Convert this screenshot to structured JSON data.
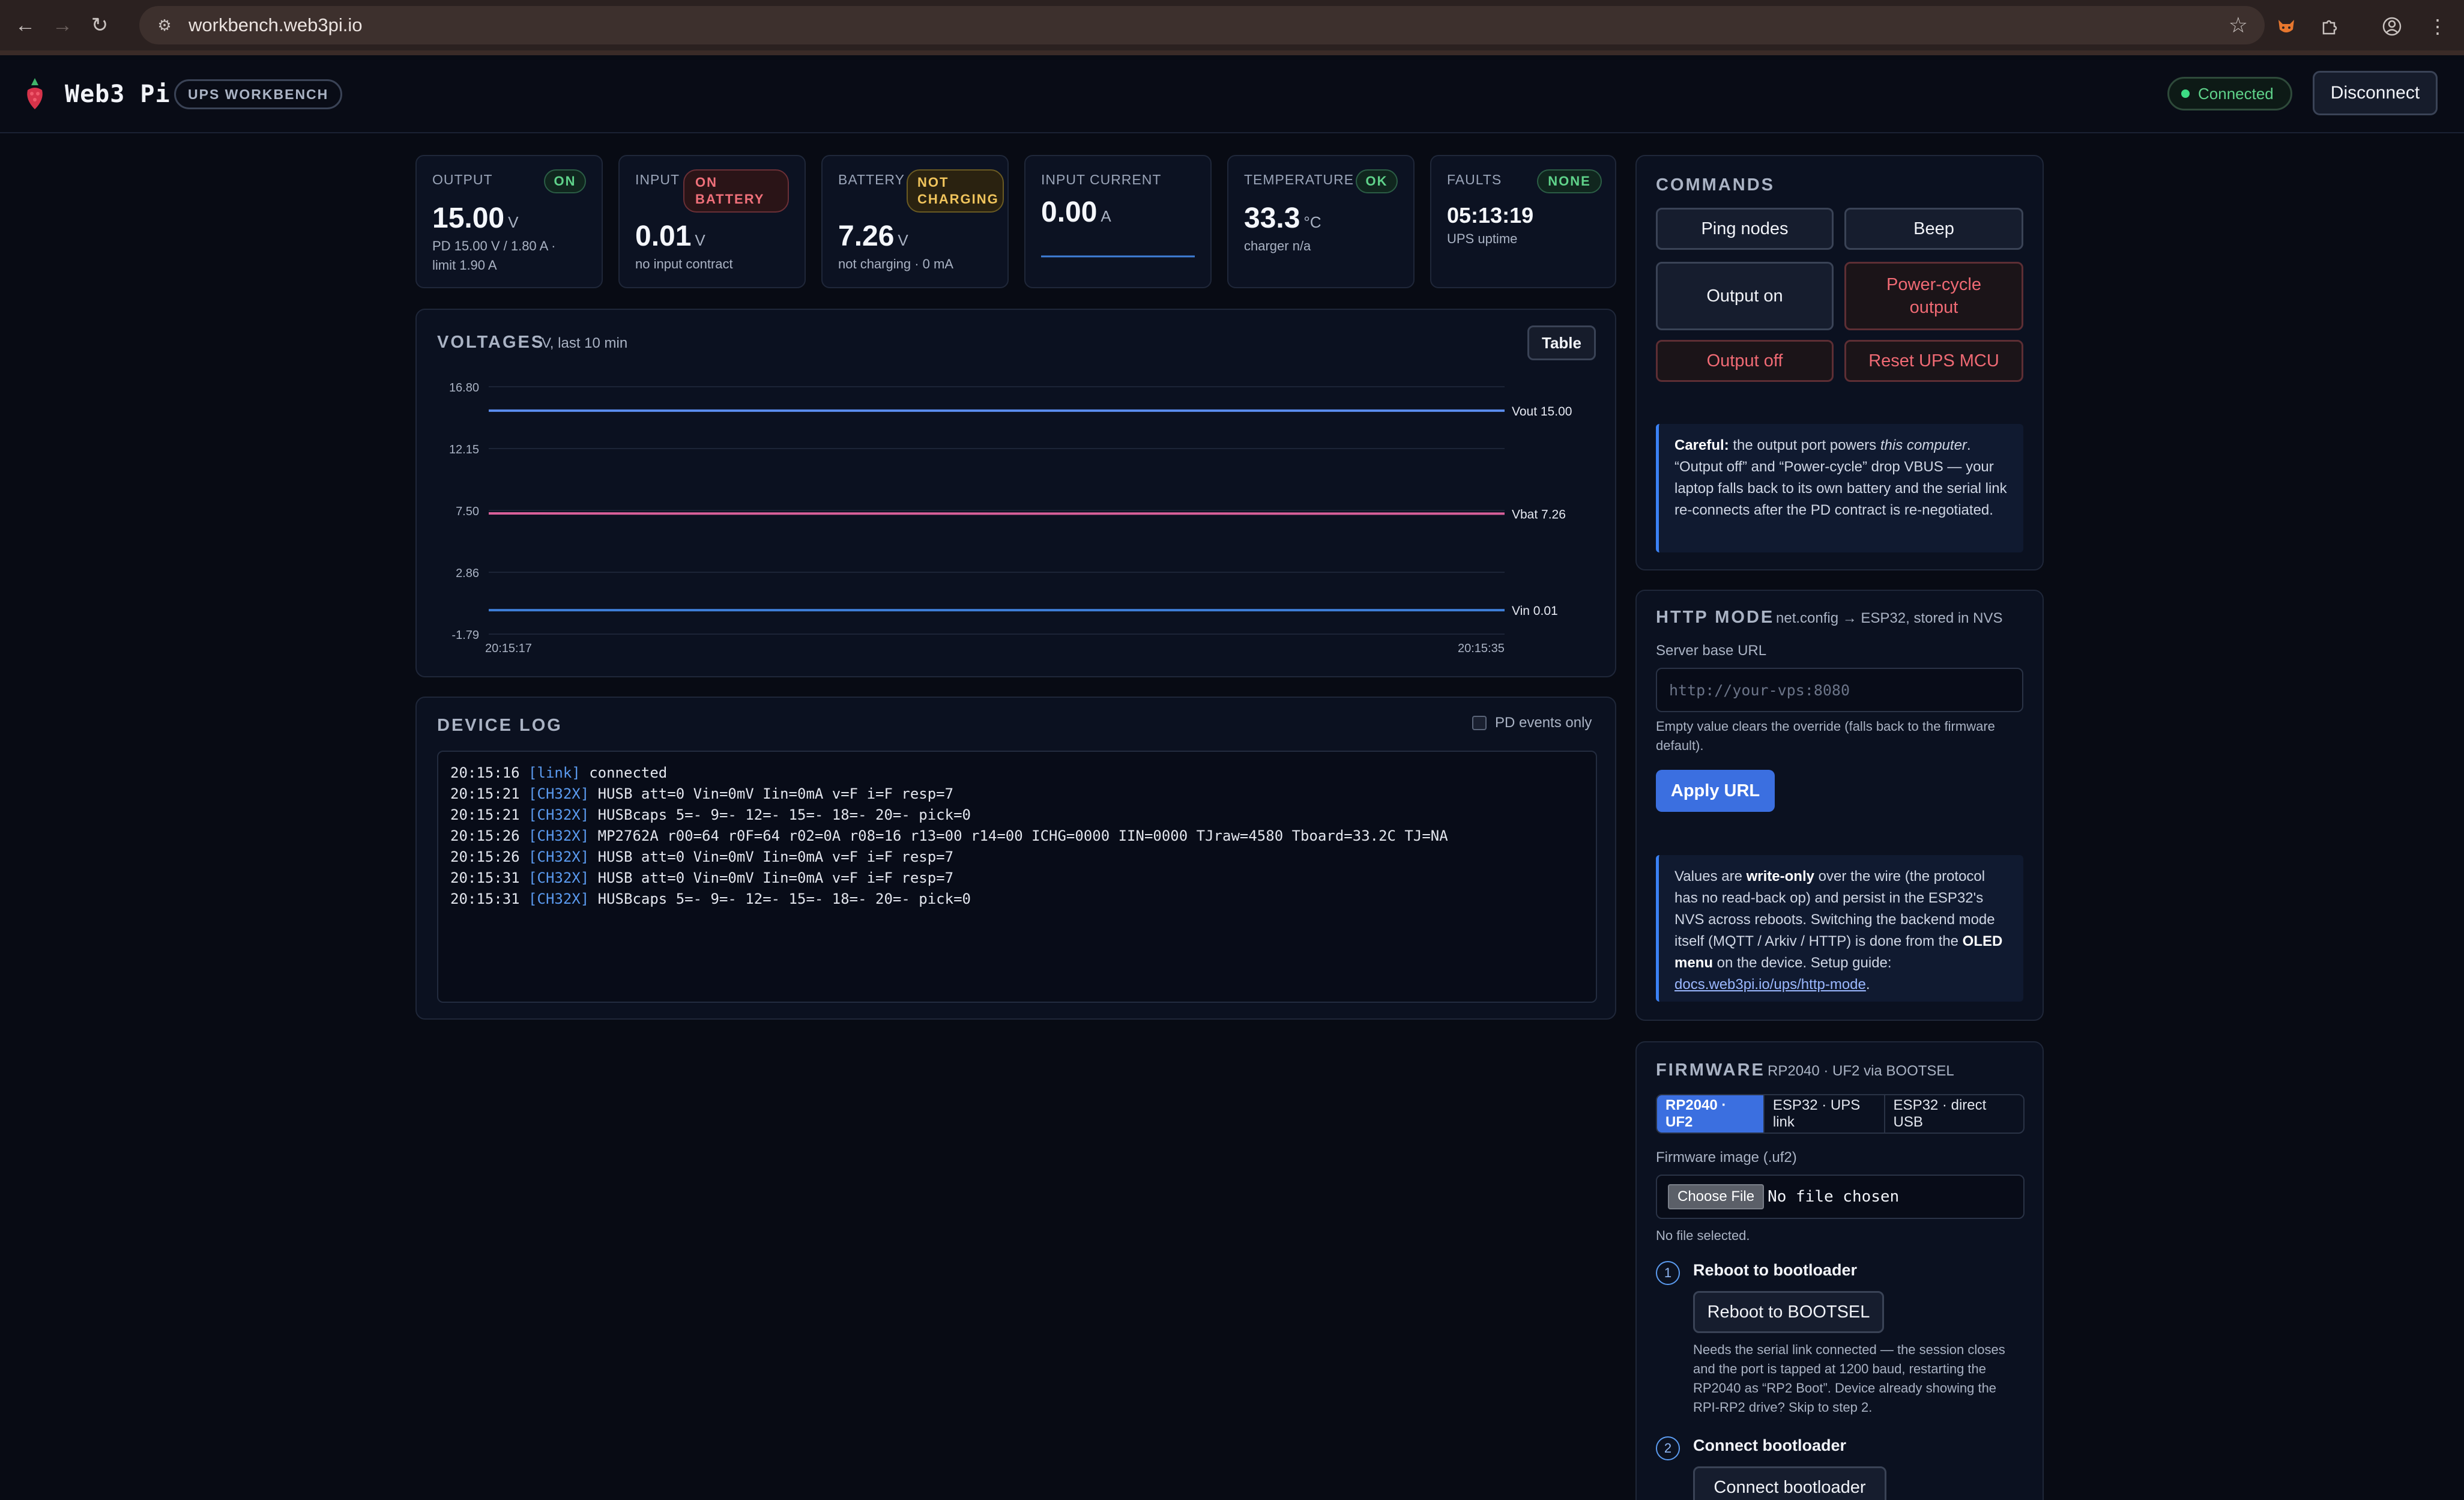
{
  "browser": {
    "url": "workbench.web3pi.io"
  },
  "header": {
    "brand": "Web3 Pi",
    "badge": "UPS WORKBENCH",
    "connection_status": "Connected",
    "disconnect_label": "Disconnect"
  },
  "stats": {
    "output": {
      "label": "OUTPUT",
      "status": "ON",
      "value": "15.00",
      "unit": "V",
      "sub1": "PD 15.00 V / 1.80 A ·",
      "sub2": "limit 1.90 A"
    },
    "input": {
      "label": "INPUT",
      "status_line1": "ON",
      "status_line2": "BATTERY",
      "value": "0.01",
      "unit": "V",
      "sub": "no input contract"
    },
    "battery": {
      "label": "BATTERY",
      "status_line1": "NOT",
      "status_line2": "CHARGING",
      "value": "7.26",
      "unit": "V",
      "sub": "not charging · 0 mA"
    },
    "input_current": {
      "label": "INPUT CURRENT",
      "value": "0.00",
      "unit": "A"
    },
    "temperature": {
      "label": "TEMPERATURE",
      "status": "OK",
      "value": "33.3",
      "unit": "°C",
      "sub": "charger n/a"
    },
    "faults": {
      "label": "FAULTS",
      "status": "NONE",
      "value": "05:13:19",
      "sub": "UPS uptime"
    }
  },
  "voltages": {
    "title": "VOLTAGES",
    "subtitle": "V, last 10 min",
    "table_label": "Table"
  },
  "chart_data": {
    "type": "line",
    "title": "VOLTAGES",
    "subtitle": "V, last 10 min",
    "ylim": [
      -1.79,
      16.8
    ],
    "yticks": [
      "16.80",
      "12.15",
      "7.50",
      "2.86",
      "-1.79"
    ],
    "xticks": [
      "20:15:17",
      "20:15:35"
    ],
    "series": [
      {
        "name": "Vout",
        "end_label": "Vout 15.00",
        "color": "#5b8def",
        "values": [
          15.0,
          15.0,
          15.0,
          15.0,
          15.0,
          15.0,
          15.0
        ]
      },
      {
        "name": "Vbat",
        "end_label": "Vbat 7.26",
        "color": "#d9609a",
        "values": [
          7.28,
          7.27,
          7.27,
          7.26,
          7.27,
          7.26,
          7.26
        ]
      },
      {
        "name": "Vin",
        "end_label": "Vin 0.01",
        "color": "#3f7fd8",
        "values": [
          0.01,
          0.01,
          0.01,
          0.01,
          0.01,
          0.01,
          0.01
        ]
      }
    ]
  },
  "device_log": {
    "title": "DEVICE LOG",
    "pd_only_label": "PD events only",
    "lines": [
      {
        "time": "20:15:16",
        "tag": "[link]",
        "text": "connected"
      },
      {
        "time": "20:15:21",
        "tag": "[CH32X]",
        "text": "HUSB att=0 Vin=0mV Iin=0mA v=F i=F resp=7"
      },
      {
        "time": "20:15:21",
        "tag": "[CH32X]",
        "text": "HUSBcaps 5=- 9=- 12=- 15=- 18=- 20=- pick=0"
      },
      {
        "time": "20:15:26",
        "tag": "[CH32X]",
        "text": "MP2762A r00=64 r0F=64 r02=0A r08=16 r13=00 r14=00 ICHG=0000 IIN=0000 TJraw=4580 Tboard=33.2C TJ=NA"
      },
      {
        "time": "20:15:26",
        "tag": "[CH32X]",
        "text": "HUSB att=0 Vin=0mV Iin=0mA v=F i=F resp=7"
      },
      {
        "time": "20:15:31",
        "tag": "[CH32X]",
        "text": "HUSB att=0 Vin=0mV Iin=0mA v=F i=F resp=7"
      },
      {
        "time": "20:15:31",
        "tag": "[CH32X]",
        "text": "HUSBcaps 5=- 9=- 12=- 15=- 18=- 20=- pick=0"
      }
    ]
  },
  "commands": {
    "title": "COMMANDS",
    "ping": "Ping nodes",
    "beep": "Beep",
    "output_on": "Output on",
    "power_cycle_1": "Power-cycle",
    "power_cycle_2": "output",
    "output_off": "Output off",
    "reset_mcu": "Reset UPS MCU",
    "careful_lead": "Careful:",
    "careful_a": " the output port powers ",
    "careful_em": "this computer",
    "careful_b": ". “Output off” and “Power-cycle” drop VBUS — your laptop falls back to its own battery and the serial link re-connects after the PD contract is re-negotiated."
  },
  "http_mode": {
    "title": "HTTP MODE",
    "subtitle": "net.config → ESP32, stored in NVS",
    "url_label": "Server base URL",
    "url_placeholder": "http://your-vps:8080",
    "url_value": "",
    "help": "Empty value clears the override (falls back to the firmware default).",
    "apply_label": "Apply URL",
    "note_a": "Values are ",
    "note_b1": "write-only",
    "note_c": " over the wire (the protocol has no read-back op) and persist in the ESP32's NVS across reboots. Switching the backend mode itself (MQTT / Arkiv / HTTP) is done from the ",
    "note_b2": "OLED menu",
    "note_d": " on the device. Setup guide: ",
    "note_link": "docs.web3pi.io/ups/http-mode",
    "note_end": "."
  },
  "firmware": {
    "title": "FIRMWARE",
    "subtitle": "RP2040 · UF2 via BOOTSEL",
    "tabs": [
      "RP2040 · UF2",
      "ESP32 · UPS link",
      "ESP32 · direct USB"
    ],
    "image_label": "Firmware image (.uf2)",
    "choose_file": "Choose File",
    "no_file_chosen": "No file chosen",
    "no_file_selected": "No file selected.",
    "step1_num": "1",
    "step1_title": "Reboot to bootloader",
    "step1_button": "Reboot to BOOTSEL",
    "step1_help": "Needs the serial link connected — the session closes and the port is tapped at 1200 baud, restarting the RP2040 as “RP2 Boot”. Device already showing the RPI-RP2 drive? Skip to step 2.",
    "step2_num": "2",
    "step2_title": "Connect bootloader",
    "step2_button": "Connect bootloader"
  }
}
